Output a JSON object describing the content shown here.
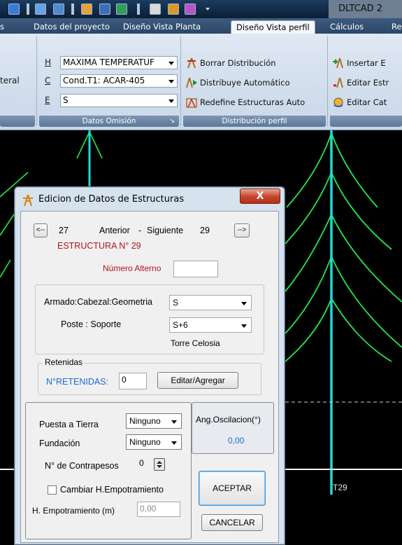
{
  "titlebar": {
    "app_title": "DLTCAD 2",
    "qat_icons": [
      "save-icon",
      "settings-icon",
      "calc-icon",
      "language-icon",
      "layers-icon",
      "structure-icon",
      "tower-icon",
      "eraser-icon",
      "dropdown-icon"
    ]
  },
  "tabs": [
    {
      "label": "s"
    },
    {
      "label": "Datos del proyecto"
    },
    {
      "label": "Diseño Vista Planta"
    },
    {
      "label": "Diseño Vista perfil",
      "active": true
    },
    {
      "label": "Cálculos"
    },
    {
      "label": "Re"
    }
  ],
  "ribbon": {
    "group0_label": "teral",
    "group1": {
      "caption": "Datos Omisión",
      "row_h_label": "H",
      "row_h_value": "MAXIMA TEMPERATUF",
      "row_c_label": "C",
      "row_c_value": "Cond.T1: ACAR-405",
      "row_e_label": "E",
      "row_e_value": "S"
    },
    "group2": {
      "caption": "Distribución perfil",
      "btn1": "Borrar Distribución",
      "btn2": "Distribuye Automático",
      "btn3": "Redefine Estructuras Auto"
    },
    "group3": {
      "btn1": "Insertar E",
      "btn2": "Editar Estr",
      "btn3": "Editar Cat"
    }
  },
  "canvas": {
    "structure_label": "T29"
  },
  "dialog": {
    "title": "Edicion de Datos de Estructuras",
    "close_label": "X",
    "prev_button": "<--",
    "prev_number": "27",
    "anterior_label": "Anterior",
    "dash": "-",
    "siguiente_label": "Siguiente",
    "next_number": "29",
    "next_button": "-->",
    "structure_heading": "ESTRUCTURA N°  29",
    "numero_alterno_label": "Número Alterno",
    "numero_alterno_value": "",
    "armado_label": "Armado:Cabezal:Geometria",
    "armado_value": "S",
    "poste_label": "Poste : Soporte",
    "poste_value": "S+6",
    "torre_label": "Torre Celosia",
    "retenidas_legend": "Retenidas",
    "nretenidas_label": "N°RETENIDAS:",
    "nretenidas_value": "0",
    "editar_button": "Editar/Agregar",
    "puesta_label": "Puesta a Tierra",
    "puesta_value": "Ninguno",
    "fundacion_label": "Fundación",
    "fundacion_value": "Ninguno",
    "contrapesos_label": "N° de Contrapesos",
    "contrapesos_value": "0",
    "ang_label": "Ang.Oscilacion(°)",
    "ang_value": "0,00",
    "cambiar_label": "Cambiar H.Empotramiento",
    "cambiar_checked": false,
    "hemp_label": "H. Empotramiento (m)",
    "hemp_value": "0,00",
    "aceptar_button": "ACEPTAR",
    "cancelar_button": "CANCELAR"
  }
}
